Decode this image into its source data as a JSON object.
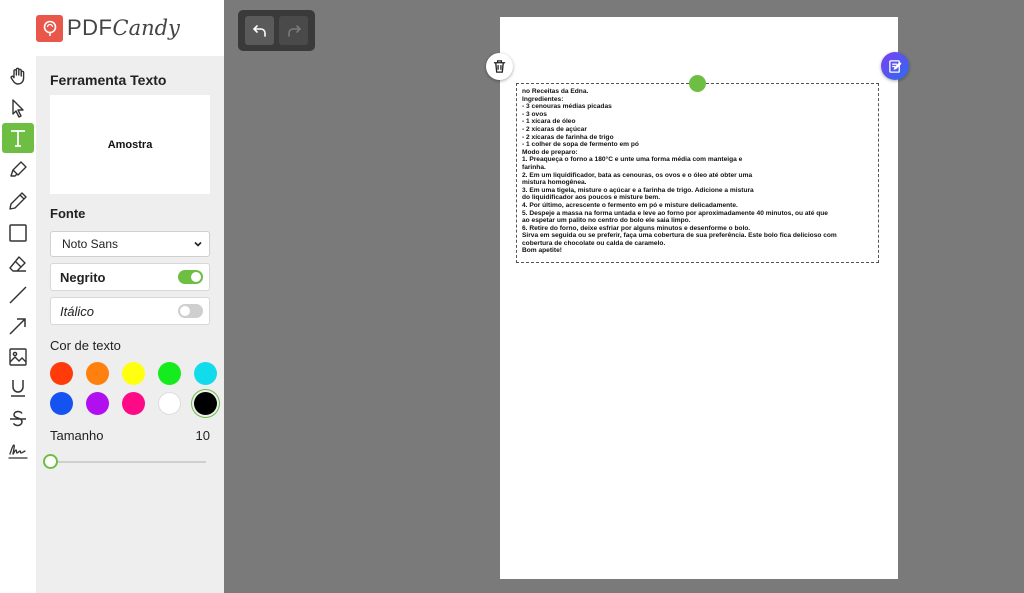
{
  "brand": {
    "name_part1": "PDF",
    "name_part2": "Candy",
    "logo_color": "#e8574a"
  },
  "accent_color": "#6fbe44",
  "tools": [
    {
      "name": "hand-icon",
      "label": "Mão"
    },
    {
      "name": "pointer-icon",
      "label": "Seleção"
    },
    {
      "name": "text-tool-icon",
      "label": "Texto",
      "active": true
    },
    {
      "name": "highlighter-icon",
      "label": "Marcador"
    },
    {
      "name": "pencil-icon",
      "label": "Lápis"
    },
    {
      "name": "rectangle-icon",
      "label": "Retângulo"
    },
    {
      "name": "eraser-icon",
      "label": "Borracha"
    },
    {
      "name": "line-icon",
      "label": "Linha"
    },
    {
      "name": "arrow-icon",
      "label": "Seta"
    },
    {
      "name": "image-icon",
      "label": "Imagem"
    },
    {
      "name": "underline-icon",
      "label": "Sublinhado"
    },
    {
      "name": "strikethrough-icon",
      "label": "Tachado"
    },
    {
      "name": "signature-icon",
      "label": "Assinatura"
    }
  ],
  "panel": {
    "title": "Ferramenta Texto",
    "sample_text": "Amostra",
    "font_label": "Fonte",
    "font_value": "Noto Sans",
    "bold_label": "Negrito",
    "bold_on": true,
    "italic_label": "Itálico",
    "italic_on": false,
    "color_label": "Cor de texto",
    "colors": [
      "#ff3b0a",
      "#ff7f0f",
      "#ffff10",
      "#14ec1e",
      "#12dcec",
      "#1452f2",
      "#b10ff0",
      "#ff0a86",
      "#ffffff",
      "#000000"
    ],
    "selected_color": "#000000",
    "size_label": "Tamanho",
    "size_value": "10"
  },
  "history": {
    "undo_icon": "undo-icon",
    "redo_icon": "redo-icon"
  },
  "document": {
    "lines": [
      "no Receitas da Edna.",
      "Ingredientes:",
      "- 3 cenouras médias picadas",
      "- 3 ovos",
      "- 1 xícara de óleo",
      "- 2 xícaras de açúcar",
      "- 2 xícaras de farinha de trigo",
      "- 1 colher de sopa de fermento em pó",
      "Modo de preparo:",
      "1. Preaqueça o forno a 180°C e unte uma forma média com manteiga e",
      "farinha.",
      "2. Em um liquidificador, bata as cenouras, os ovos e o óleo até obter uma",
      "mistura homogênea.",
      "3. Em uma tigela, misture o açúcar e a farinha de trigo. Adicione a mistura",
      "do liquidificador aos poucos e misture bem.",
      "4. Por último, acrescente o fermento em pó e misture delicadamente.",
      "5. Despeje a massa na forma untada e leve ao forno por aproximadamente 40 minutos, ou até que",
      "ao espetar um palito no centro do bolo ele saia limpo.",
      "6. Retire do forno, deixe esfriar por alguns minutos e desenforme o bolo.",
      "Sirva em seguida ou se preferir, faça uma cobertura de sua preferência. Este bolo fica delicioso com",
      "cobertura de chocolate ou calda de caramelo.",
      "Bom apetite!"
    ]
  }
}
